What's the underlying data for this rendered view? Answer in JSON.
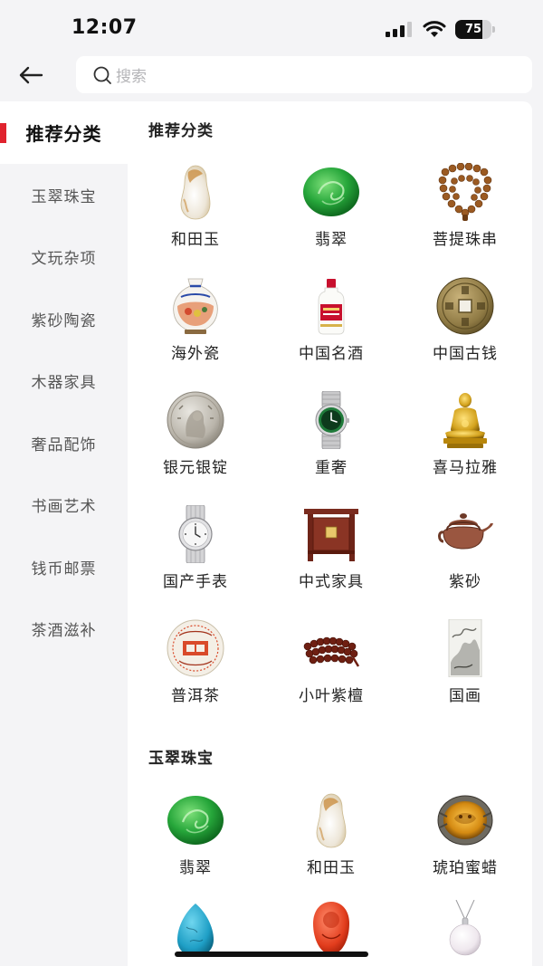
{
  "status": {
    "time": "12:07",
    "battery": "75",
    "battery_level": 0.75
  },
  "search": {
    "placeholder": "搜索"
  },
  "sidebar": {
    "items": [
      {
        "label": "推荐分类",
        "active": true
      },
      {
        "label": "玉翠珠宝"
      },
      {
        "label": "文玩杂项"
      },
      {
        "label": "紫砂陶瓷"
      },
      {
        "label": "木器家具"
      },
      {
        "label": "奢品配饰"
      },
      {
        "label": "书画艺术"
      },
      {
        "label": "钱币邮票"
      },
      {
        "label": "茶酒滋补"
      }
    ]
  },
  "sections": [
    {
      "title": "推荐分类",
      "items": [
        {
          "label": "和田玉",
          "icon": "hetian-jade-icon"
        },
        {
          "label": "翡翠",
          "icon": "jadeite-icon"
        },
        {
          "label": "菩提珠串",
          "icon": "bodhi-beads-icon"
        },
        {
          "label": "海外瓷",
          "icon": "overseas-porcelain-icon"
        },
        {
          "label": "中国名酒",
          "icon": "liquor-bottle-icon"
        },
        {
          "label": "中国古钱",
          "icon": "ancient-coin-icon"
        },
        {
          "label": "银元银锭",
          "icon": "silver-dollar-icon"
        },
        {
          "label": "重奢",
          "icon": "luxury-watch-icon"
        },
        {
          "label": "喜马拉雅",
          "icon": "buddha-statue-icon"
        },
        {
          "label": "国产手表",
          "icon": "domestic-watch-icon"
        },
        {
          "label": "中式家具",
          "icon": "chinese-furniture-icon"
        },
        {
          "label": "紫砂",
          "icon": "teapot-icon"
        },
        {
          "label": "普洱茶",
          "icon": "puer-tea-cake-icon"
        },
        {
          "label": "小叶紫檀",
          "icon": "sandalwood-beads-icon"
        },
        {
          "label": "国画",
          "icon": "chinese-painting-icon"
        }
      ]
    },
    {
      "title": "玉翠珠宝",
      "items": [
        {
          "label": "翡翠",
          "icon": "jadeite-icon"
        },
        {
          "label": "和田玉",
          "icon": "hetian-jade-icon"
        },
        {
          "label": "琥珀蜜蜡",
          "icon": "amber-ring-icon"
        },
        {
          "label": "",
          "icon": "turquoise-icon"
        },
        {
          "label": "",
          "icon": "red-coral-icon"
        },
        {
          "label": "",
          "icon": "pearl-pendant-icon"
        }
      ]
    }
  ],
  "colors": {
    "accent": "#e0232e",
    "background": "#f4f4f6"
  }
}
